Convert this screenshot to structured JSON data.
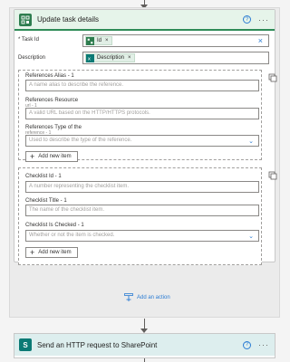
{
  "action": {
    "title": "Update task details",
    "help": "?",
    "more": "···",
    "fields": {
      "task_id_label": "* Task Id",
      "task_id_token": "Id",
      "token_close": "×",
      "clear": "×",
      "description_label": "Description",
      "description_token": "Description"
    },
    "references": {
      "alias_label": "References Alias - 1",
      "alias_placeholder": "A name alias to describe the reference.",
      "resource_label": "References Resource",
      "resource_label_cont": "url - 1",
      "resource_placeholder": "A valid URL based on the HTTP/HTTPS protocols.",
      "type_label": "References Type of the",
      "type_label_cont": "reference - 1",
      "type_placeholder": "Used to describe the type of the reference.",
      "add_new_item": "Add new item"
    },
    "checklist": {
      "id_label": "Checklist Id - 1",
      "id_placeholder": "A number representing the checklist item.",
      "title_label": "Checklist Title - 1",
      "title_placeholder": "The name of the checklist item.",
      "checked_label": "Checklist Is Checked - 1",
      "checked_placeholder": "Whether or not the item is checked.",
      "add_new_item": "Add new item"
    }
  },
  "add_action_label": "Add an action",
  "next_action": {
    "title": "Send an HTTP request to SharePoint",
    "icon_letter": "S",
    "help": "?",
    "more": "···"
  },
  "colors": {
    "accent": "#2b7cd3",
    "planner_green": "#2e7d4f",
    "sharepoint_teal": "#0b7a75"
  }
}
